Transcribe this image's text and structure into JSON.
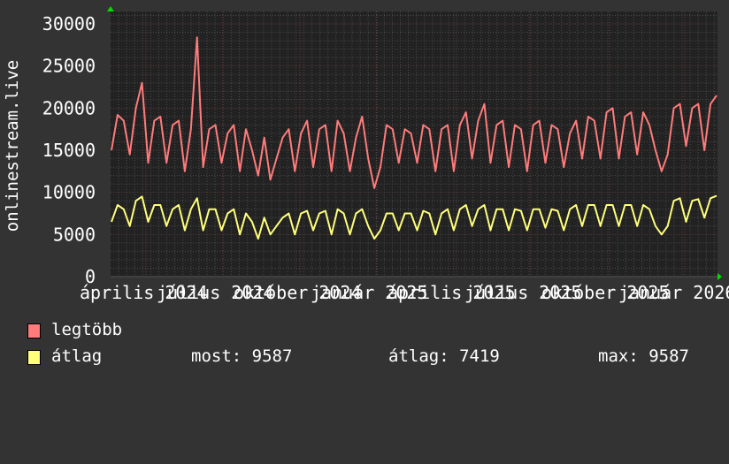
{
  "chart_data": {
    "type": "line",
    "ylabel": "onlinestream.live",
    "xlabel": "",
    "ylim": [
      0,
      30000
    ],
    "y_ticks": [
      "0",
      "5000",
      "10000",
      "15000",
      "20000",
      "25000",
      "30000"
    ],
    "x_tick_labels": [
      "április 2024",
      "július 2024",
      "október 2024",
      "január 2025",
      "április 2025",
      "július 2025",
      "október 2025",
      "január 2026"
    ],
    "grid": true,
    "legend_placement": "bottom-left",
    "series": [
      {
        "name": "legtöbb",
        "color": "#ff7b7b",
        "values": [
          15000,
          19200,
          18500,
          14500,
          20000,
          23000,
          13500,
          18500,
          19000,
          13500,
          18000,
          18500,
          12500,
          17500,
          28400,
          13000,
          17500,
          18000,
          13500,
          17000,
          18000,
          12500,
          17500,
          15000,
          12000,
          16500,
          11500,
          14000,
          16500,
          17500,
          12500,
          17000,
          18500,
          13000,
          17500,
          18000,
          12500,
          18500,
          17000,
          12500,
          16500,
          19000,
          14000,
          10500,
          13000,
          18000,
          17500,
          13500,
          17500,
          17000,
          13500,
          18000,
          17500,
          12500,
          17500,
          18000,
          12500,
          18000,
          19500,
          14000,
          18500,
          20500,
          13500,
          18000,
          18500,
          13000,
          18000,
          17500,
          12500,
          18000,
          18500,
          13500,
          18000,
          17500,
          13000,
          17000,
          18500,
          14000,
          19000,
          18500,
          14000,
          19500,
          20000,
          14000,
          19000,
          19500,
          14500,
          19500,
          18000,
          15000,
          12500,
          14500,
          20000,
          20500,
          15500,
          20000,
          20500,
          15000,
          20500,
          21500
        ]
      },
      {
        "name": "átlag",
        "color": "#ffff7b",
        "values": [
          6500,
          8500,
          8000,
          6000,
          9000,
          9500,
          6500,
          8500,
          8500,
          6000,
          8000,
          8500,
          5500,
          8000,
          9300,
          5500,
          8000,
          8000,
          5500,
          7500,
          8000,
          5000,
          7500,
          6500,
          4500,
          7000,
          5000,
          6000,
          7000,
          7500,
          5000,
          7500,
          7800,
          5500,
          7500,
          7800,
          5000,
          8000,
          7500,
          5000,
          7500,
          8000,
          6000,
          4500,
          5500,
          7500,
          7500,
          5500,
          7500,
          7500,
          5500,
          7800,
          7500,
          5000,
          7500,
          8000,
          5500,
          8000,
          8500,
          6000,
          8000,
          8500,
          5500,
          8000,
          8000,
          5500,
          8000,
          7800,
          5500,
          8000,
          8000,
          5800,
          8000,
          7800,
          5500,
          8000,
          8500,
          6000,
          8500,
          8500,
          6000,
          8500,
          8500,
          6000,
          8500,
          8500,
          6000,
          8500,
          8000,
          6000,
          5000,
          6000,
          9000,
          9300,
          6500,
          9000,
          9200,
          7000,
          9300,
          9587
        ]
      }
    ]
  },
  "legend": {
    "max_label": "legtöbb",
    "avg_label": "átlag",
    "stats": {
      "now": "most: 9587",
      "avg": "átlag: 7419",
      "max": "max: 9587"
    }
  }
}
